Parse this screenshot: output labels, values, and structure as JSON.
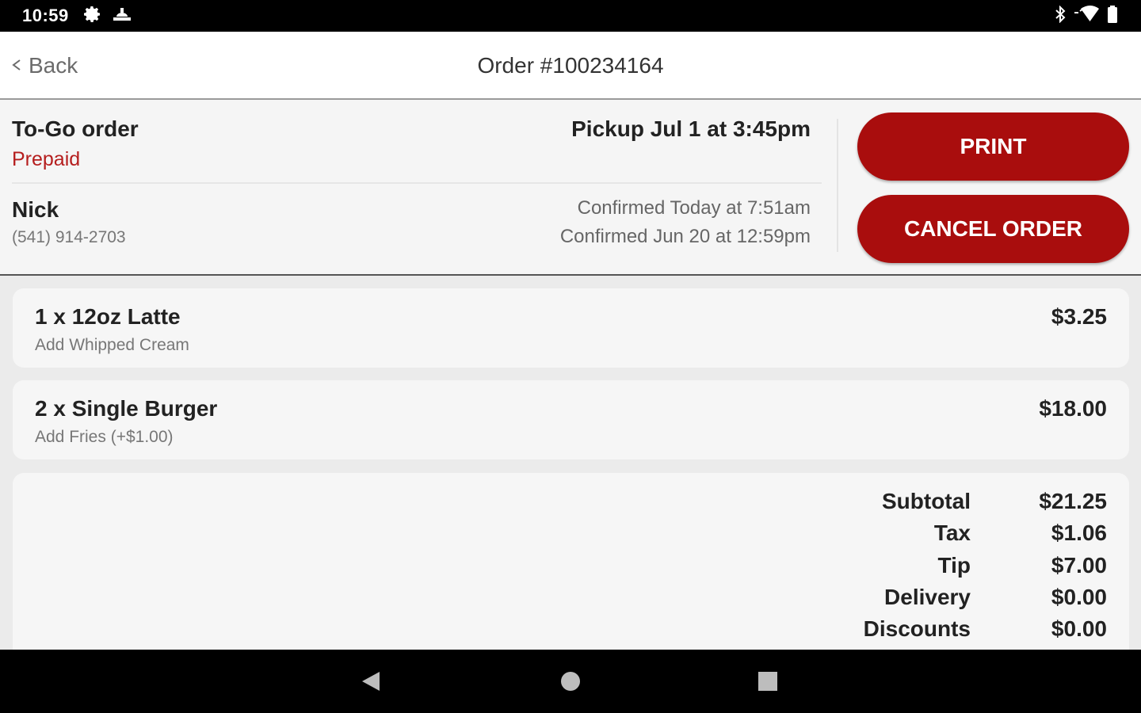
{
  "status_bar": {
    "time": "10:59",
    "left_icons": [
      "gear-icon",
      "notification-icon"
    ],
    "right_icons": [
      "bluetooth-icon",
      "wifi-icon",
      "battery-icon"
    ]
  },
  "header": {
    "back_label": "Back",
    "title": "Order #100234164"
  },
  "order": {
    "type": "To-Go order",
    "payment_status": "Prepaid",
    "pickup": "Pickup Jul 1 at 3:45pm",
    "customer_name": "Nick",
    "customer_phone": "(541) 914-2703",
    "confirmations": [
      "Confirmed Today at 7:51am",
      "Confirmed Jun 20 at 12:59pm"
    ]
  },
  "actions": {
    "print_label": "PRINT",
    "cancel_label": "CANCEL ORDER"
  },
  "items": [
    {
      "title": "1 x 12oz Latte",
      "modifier": "Add Whipped Cream",
      "price": "$3.25"
    },
    {
      "title": "2 x Single Burger",
      "modifier": "Add Fries (+$1.00)",
      "price": "$18.00"
    }
  ],
  "totals": [
    {
      "label": "Subtotal",
      "value": "$21.25"
    },
    {
      "label": "Tax",
      "value": "$1.06"
    },
    {
      "label": "Tip",
      "value": "$7.00"
    },
    {
      "label": "Delivery",
      "value": "$0.00"
    },
    {
      "label": "Discounts",
      "value": "$0.00"
    }
  ],
  "colors": {
    "accent": "#a90d0d",
    "prepaid_text": "#b51e1e"
  },
  "nav_bar": [
    "back-triangle-icon",
    "home-circle-icon",
    "recents-square-icon"
  ]
}
